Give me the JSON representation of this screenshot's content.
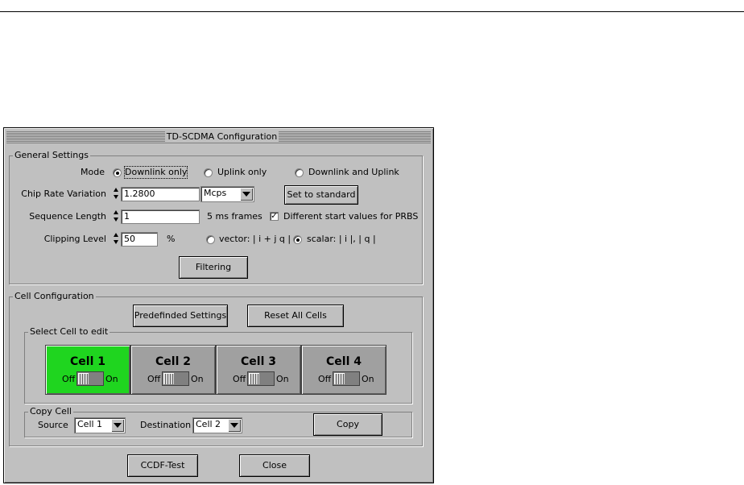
{
  "dialog": {
    "title": "TD-SCDMA Configuration"
  },
  "general": {
    "legend": "General Settings",
    "mode_label": "Mode",
    "mode_options": [
      "Downlink only",
      "Uplink only",
      "Downlink and Uplink"
    ],
    "mode_selected": "Downlink only",
    "chip_rate_label": "Chip Rate Variation",
    "chip_rate_value": "1.2800",
    "chip_rate_unit": "Mcps",
    "set_standard_label": "Set to standard",
    "seq_len_label": "Sequence Length",
    "seq_len_value": "1",
    "seq_len_unit": "5 ms frames",
    "prbs_label": "Different start values for PRBS",
    "prbs_checked": true,
    "clip_label": "Clipping Level",
    "clip_value": "50",
    "clip_unit": "%",
    "clip_vector_label": "vector: | i + j q |",
    "clip_scalar_label": "scalar: | i |, | q |",
    "clip_selected": "scalar",
    "filtering_label": "Filtering"
  },
  "cellconf": {
    "legend": "Cell Configuration",
    "predefined_label": "Predefinded Settings",
    "reset_label": "Reset All Cells",
    "select_legend": "Select Cell to edit",
    "off_label": "Off",
    "on_label": "On",
    "cells": [
      {
        "name": "Cell 1",
        "active": true
      },
      {
        "name": "Cell 2",
        "active": false
      },
      {
        "name": "Cell 3",
        "active": false
      },
      {
        "name": "Cell 4",
        "active": false
      }
    ],
    "copy_legend": "Copy Cell",
    "source_label": "Source",
    "source_value": "Cell 1",
    "dest_label": "Destination",
    "dest_value": "Cell 2",
    "copy_label": "Copy"
  },
  "footer": {
    "ccdf_label": "CCDF-Test",
    "close_label": "Close"
  },
  "colors": {
    "active_cell": "#1fd51f",
    "dialog_bg": "#c0c0c0"
  }
}
